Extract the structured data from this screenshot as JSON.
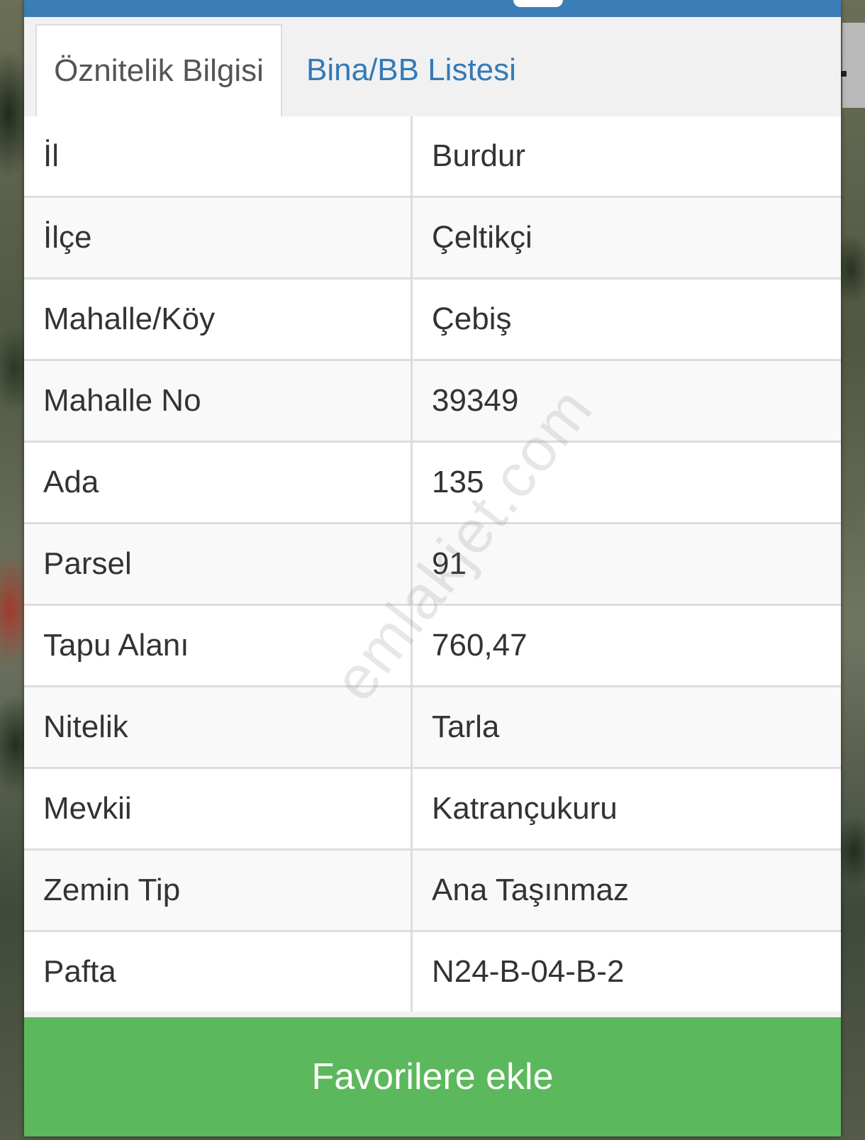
{
  "tabs": [
    {
      "label": "Öznitelik Bilgisi",
      "active": true
    },
    {
      "label": "Bina/BB Listesi",
      "active": false
    }
  ],
  "rows": [
    {
      "label": "İl",
      "value": "Burdur"
    },
    {
      "label": "İlçe",
      "value": "Çeltikçi"
    },
    {
      "label": "Mahalle/Köy",
      "value": "Çebiş"
    },
    {
      "label": "Mahalle No",
      "value": "39349"
    },
    {
      "label": "Ada",
      "value": "135"
    },
    {
      "label": "Parsel",
      "value": "91"
    },
    {
      "label": "Tapu Alanı",
      "value": "760,47"
    },
    {
      "label": "Nitelik",
      "value": "Tarla"
    },
    {
      "label": "Mevkii",
      "value": "Katrançukuru"
    },
    {
      "label": "Zemin Tip",
      "value": "Ana Taşınmaz"
    },
    {
      "label": "Pafta",
      "value": "N24-B-04-B-2"
    }
  ],
  "favorite_button_label": "Favorilere ekle",
  "watermark": "emlakjet.com",
  "colors": {
    "header": "#3a7db7",
    "tab_link": "#337ab7",
    "button": "#5cb85c",
    "row_alt": "#f9f9f9",
    "border": "#dddddd"
  }
}
